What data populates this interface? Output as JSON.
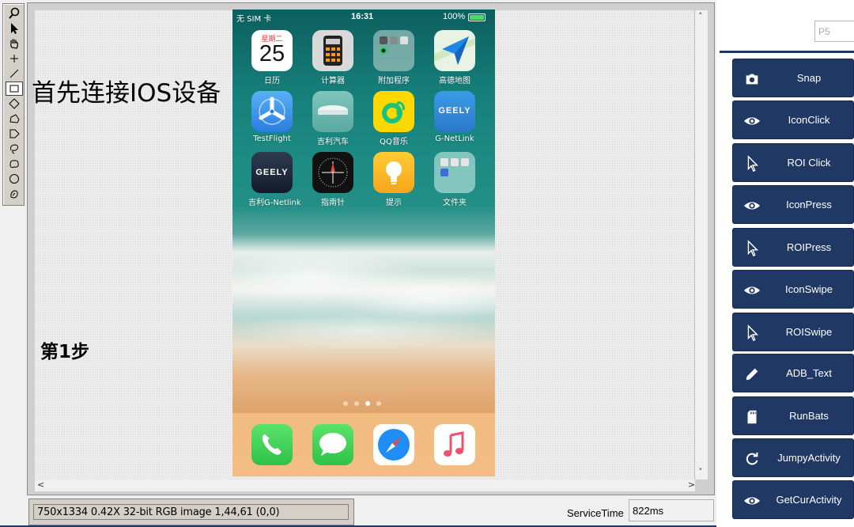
{
  "canvas": {
    "note_title": "首先连接IOS设备",
    "note_step": "第1步"
  },
  "phone": {
    "status": {
      "carrier": "无 SIM 卡",
      "time": "16:31",
      "battery": "100%"
    },
    "apps": [
      {
        "label": "日历",
        "icon": "calendar-icon",
        "day_name": "星期二",
        "day_number": "25"
      },
      {
        "label": "计算器",
        "icon": "calculator-icon"
      },
      {
        "label": "附加程序",
        "icon": "folder-icon"
      },
      {
        "label": "高德地图",
        "icon": "map-icon"
      },
      {
        "label": "TestFlight",
        "icon": "testflight-icon"
      },
      {
        "label": "吉利汽车",
        "icon": "geely-car-icon"
      },
      {
        "label": "QQ音乐",
        "icon": "qq-music-icon"
      },
      {
        "label": "G-NetLink",
        "icon": "geely-netlink-icon",
        "logo_text": "GEELY"
      },
      {
        "label": "吉利G-Netlink",
        "icon": "geely-g-netlink-icon",
        "logo_text": "GEELY"
      },
      {
        "label": "指南针",
        "icon": "compass-icon"
      },
      {
        "label": "提示",
        "icon": "tips-icon"
      },
      {
        "label": "文件夹",
        "icon": "folder-icon"
      }
    ],
    "dock": [
      {
        "icon": "phone-icon"
      },
      {
        "icon": "messages-icon"
      },
      {
        "icon": "safari-icon"
      },
      {
        "icon": "music-icon"
      }
    ]
  },
  "statusbar": {
    "image_info": "750x1334 0.42X 32-bit RGB image 1,44,61     (0,0)",
    "service_time_label": "ServiceTime",
    "service_time_value": "822ms"
  },
  "panel": {
    "p_input_value": "P5",
    "buttons": [
      {
        "label": "Snap",
        "icon": "camera-icon"
      },
      {
        "label": "IconClick",
        "icon": "eye-icon"
      },
      {
        "label": "ROI Click",
        "icon": "cursor-icon"
      },
      {
        "label": "IconPress",
        "icon": "eye-icon"
      },
      {
        "label": "ROIPress",
        "icon": "cursor-icon"
      },
      {
        "label": "IconSwipe",
        "icon": "eye-icon"
      },
      {
        "label": "ROISwipe",
        "icon": "cursor-icon"
      },
      {
        "label": "ADB_Text",
        "icon": "pencil-icon"
      },
      {
        "label": "RunBats",
        "icon": "sd-card-icon"
      },
      {
        "label": "JumpyActivity",
        "icon": "refresh-icon"
      },
      {
        "label": "GetCurActivity",
        "icon": "eye-icon"
      }
    ]
  },
  "colors": {
    "button_bg": "#1f3864",
    "accent_green": "#4cd964"
  }
}
